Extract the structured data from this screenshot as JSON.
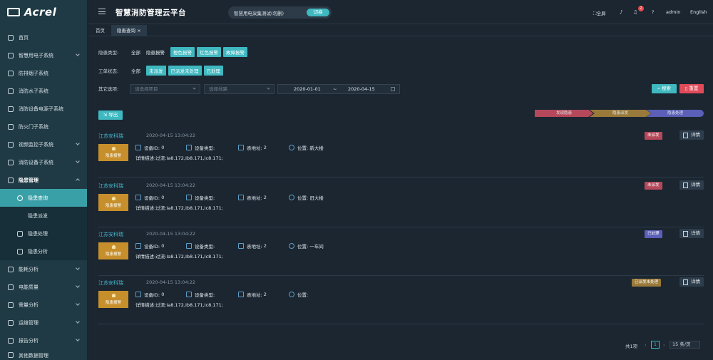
{
  "brand": {
    "logo_text": "Acrel"
  },
  "header": {
    "title": "智慧消防管理云平台",
    "project": "智慧用电采集测试(勿删)",
    "switch_label": "切换",
    "fullscreen": "全屏",
    "notification_count": "2",
    "user": "admin",
    "language": "English"
  },
  "sidebar": {
    "items": [
      {
        "label": "首页",
        "icon": "home-icon"
      },
      {
        "label": "智慧用电子系统",
        "icon": "power-icon"
      },
      {
        "label": "防排烟子系统",
        "icon": "lock-icon"
      },
      {
        "label": "消防水子系统",
        "icon": "water-icon"
      },
      {
        "label": "消防设备电源子系统",
        "icon": "lock-icon"
      },
      {
        "label": "防火门子系统",
        "icon": "door-icon"
      },
      {
        "label": "视频监控子系统",
        "icon": "video-icon"
      },
      {
        "label": "消防设备子系统",
        "icon": "device-icon"
      },
      {
        "label": "隐患管理",
        "icon": "warning-icon"
      }
    ],
    "sub_items": [
      {
        "label": "隐患查询",
        "icon": "search-icon"
      },
      {
        "label": "隐患派发",
        "icon": "check-icon"
      },
      {
        "label": "隐患处理",
        "icon": "lock-icon"
      },
      {
        "label": "隐患分析",
        "icon": "document-icon"
      }
    ],
    "bottom_items": [
      {
        "label": "能耗分析",
        "icon": "energy-icon"
      },
      {
        "label": "电能质量",
        "icon": "quality-icon"
      },
      {
        "label": "需量分析",
        "icon": "demand-icon"
      },
      {
        "label": "运维管理",
        "icon": "maintenance-icon"
      },
      {
        "label": "报告分析",
        "icon": "report-icon"
      },
      {
        "label": "其他数据管理",
        "icon": "data-icon"
      }
    ]
  },
  "tabs": [
    {
      "label": "首页"
    },
    {
      "label": "隐患查询"
    }
  ],
  "filters": {
    "type_label": "隐患类型:",
    "type_all": "全部",
    "type_opt": "隐患报警",
    "type_chips": [
      "橙色报警",
      "红色报警",
      "故障报警"
    ],
    "status_label": "工单状态:",
    "status_all": "全部",
    "status_chips": [
      "未派发",
      "已派发未处理",
      "已处理"
    ],
    "other_label": "其它选项:",
    "project_placeholder": "请选择项目",
    "line_placeholder": "选择线路",
    "date_start": "2020-01-01",
    "date_sep": "~",
    "date_end": "2020-04-15",
    "search_btn": "搜索",
    "reset_btn": "重置"
  },
  "actions": {
    "export": "导出"
  },
  "steps": [
    "发现隐患",
    "隐患派发",
    "隐患处理"
  ],
  "labels": {
    "alarm_tag": "隐患报警",
    "device_id": "设备ID:",
    "device_type": "设备类型:",
    "meter_addr": "表地址:",
    "location": "位置:",
    "detail_desc": "详情描述:",
    "detail_btn": "详情"
  },
  "records": [
    {
      "company": "江苏安科瑞",
      "time": "2020-04-15 13:04:22",
      "device_id": "0",
      "meter": "2",
      "location": "新大楼",
      "desc": "过流:Ia8.172,Ib8.171,Ic8.171;",
      "status": "未派发",
      "status_color": "#b5485a"
    },
    {
      "company": "江苏安科瑞",
      "time": "2020-04-15 13:04:22",
      "device_id": "0",
      "meter": "2",
      "location": "旧大楼",
      "desc": "过流:Ia8.172,Ib8.171,Ic8.171;",
      "status": "未派发",
      "status_color": "#b5485a"
    },
    {
      "company": "江苏安科瑞",
      "time": "2020-04-15 13:04:22",
      "device_id": "0",
      "meter": "2",
      "location": "一车间",
      "desc": "过流:Ia8.172,Ib8.171,Ic8.171;",
      "status": "已处理",
      "status_color": "#5b5fb8"
    },
    {
      "company": "江苏安科瑞",
      "time": "2020-04-15 13:04:22",
      "device_id": "0",
      "meter": "2",
      "location": "",
      "desc": "过流:Ia8.172,Ib8.171,Ic8.171;",
      "status": "已派发未处理",
      "status_color": "#9a7a3a"
    }
  ],
  "pagination": {
    "total": "共1项",
    "current": "1",
    "page_size": "15 条/页"
  },
  "colors": {
    "accent": "#3fb8c0",
    "danger": "#e04b5a",
    "step1": "#b5485a",
    "step2": "#9a7a3a",
    "step3": "#5b5fb8"
  }
}
